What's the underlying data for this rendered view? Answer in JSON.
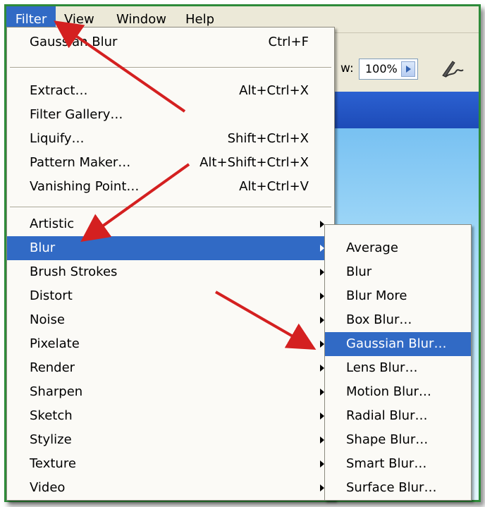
{
  "menubar": {
    "items": [
      "Filter",
      "View",
      "Window",
      "Help"
    ],
    "active": "Filter"
  },
  "toolbar": {
    "zoom_label": "w:",
    "zoom_value": "100%",
    "zoom_arrow_icon": "right-arrow-icon",
    "pen_icon": "pen-tool-icon"
  },
  "filter_menu": {
    "last_filter": {
      "label": "Gaussian Blur",
      "shortcut": "Ctrl+F"
    },
    "commands": [
      {
        "label": "Extract…",
        "shortcut": "Alt+Ctrl+X"
      },
      {
        "label": "Filter Gallery…",
        "shortcut": ""
      },
      {
        "label": "Liquify…",
        "shortcut": "Shift+Ctrl+X"
      },
      {
        "label": "Pattern Maker…",
        "shortcut": "Alt+Shift+Ctrl+X"
      },
      {
        "label": "Vanishing Point…",
        "shortcut": "Alt+Ctrl+V"
      }
    ],
    "categories": [
      "Artistic",
      "Blur",
      "Brush Strokes",
      "Distort",
      "Noise",
      "Pixelate",
      "Render",
      "Sharpen",
      "Sketch",
      "Stylize",
      "Texture",
      "Video"
    ],
    "highlighted": "Blur"
  },
  "blur_submenu": {
    "items": [
      "Average",
      "Blur",
      "Blur More",
      "Box Blur…",
      "Gaussian Blur…",
      "Lens Blur…",
      "Motion Blur…",
      "Radial Blur…",
      "Shape Blur…",
      "Smart Blur…",
      "Surface Blur…"
    ],
    "highlighted": "Gaussian Blur…"
  },
  "colors": {
    "highlight": "#316ac5",
    "annotation_arrow": "#d42020",
    "frame_border": "#2e8b3a"
  }
}
